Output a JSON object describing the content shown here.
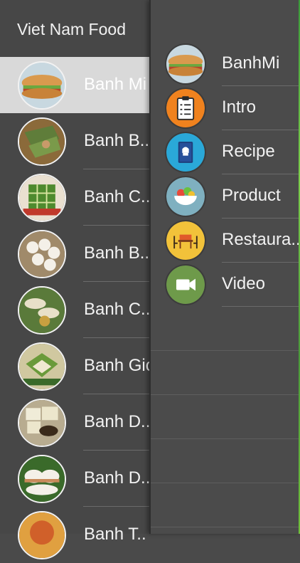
{
  "header": {
    "title": "Viet Nam Food"
  },
  "list": {
    "items": [
      {
        "label": "Banh Mi"
      },
      {
        "label": "Banh B.."
      },
      {
        "label": "Banh C.."
      },
      {
        "label": "Banh B.."
      },
      {
        "label": "Banh C.."
      },
      {
        "label": "Banh Gio"
      },
      {
        "label": "Banh D.."
      },
      {
        "label": "Banh D.."
      },
      {
        "label": "Banh T.."
      }
    ]
  },
  "menu": {
    "items": [
      {
        "label": "BanhMi",
        "icon": "banh-mi-photo-icon"
      },
      {
        "label": "Intro",
        "icon": "clipboard-icon"
      },
      {
        "label": "Recipe",
        "icon": "recipe-book-icon"
      },
      {
        "label": "Product",
        "icon": "salad-bowl-icon"
      },
      {
        "label": "Restaura..",
        "icon": "restaurant-table-icon"
      },
      {
        "label": "Video",
        "icon": "video-camera-icon"
      }
    ]
  },
  "colors": {
    "background": "#4a4a4a",
    "selected": "#d9d9d9",
    "text": "#f2f2f2"
  }
}
